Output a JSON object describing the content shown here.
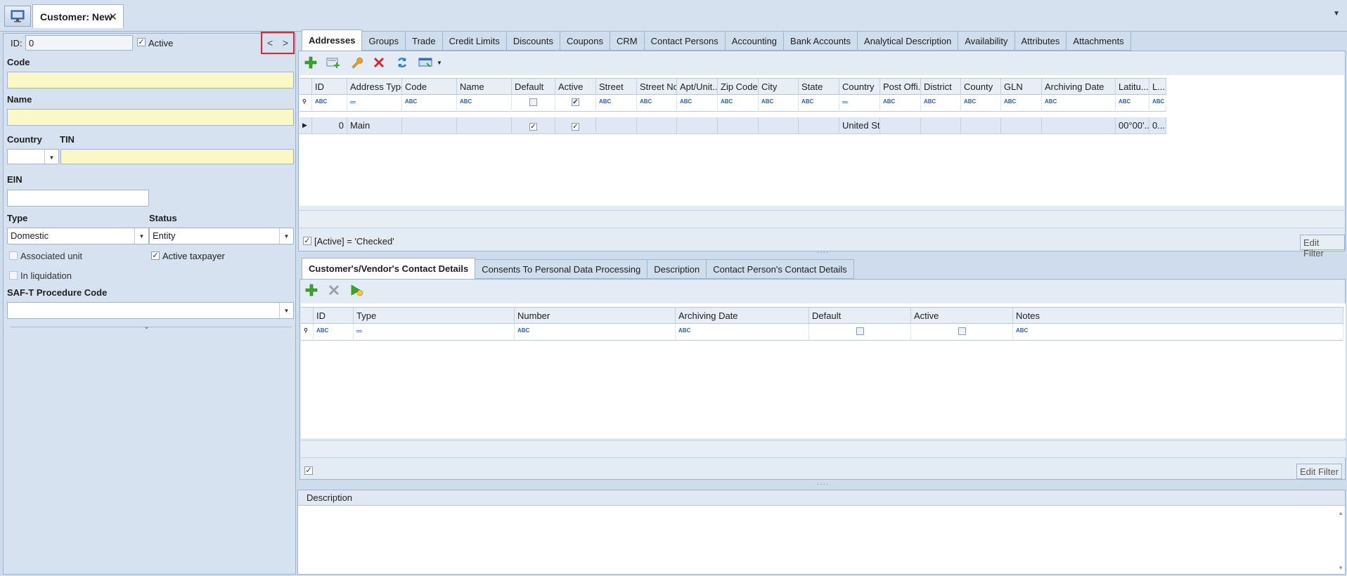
{
  "window": {
    "home_icon": "monitor-icon",
    "doc_tab_title": "Customer: New",
    "close_symbol": "✕",
    "menu_arrow": "▼"
  },
  "form": {
    "id_label": "ID:",
    "id_value": "0",
    "active_label": "Active",
    "active_checked": true,
    "nav_prev": "<",
    "nav_next": ">",
    "code_label": "Code",
    "code_value": "",
    "name_label": "Name",
    "name_value": "",
    "country_label": "Country",
    "country_value": "",
    "tin_label": "TIN",
    "tin_value": "",
    "ein_label": "EIN",
    "ein_value": "",
    "type_label": "Type",
    "type_value": "Domestic",
    "status_label": "Status",
    "status_value": "Entity",
    "associated_unit_label": "Associated unit",
    "active_taxpayer_label": "Active taxpayer",
    "in_liquidation_label": "In liquidation",
    "saft_label": "SAF-T Procedure Code",
    "saft_value": ""
  },
  "main_tabs": [
    "Addresses",
    "Groups",
    "Trade",
    "Credit Limits",
    "Discounts",
    "Coupons",
    "CRM",
    "Contact Persons",
    "Accounting",
    "Bank Accounts",
    "Analytical Description",
    "Availability",
    "Attributes",
    "Attachments"
  ],
  "addresses_grid": {
    "columns": [
      "ID",
      "Address Type",
      "Code",
      "Name",
      "Default",
      "Active",
      "Street",
      "Street No.",
      "Apt/Unit...",
      "Zip Code",
      "City",
      "State",
      "Country",
      "Post Offi...",
      "District",
      "County",
      "GLN",
      "Archiving Date",
      "Latitu...",
      "L..."
    ],
    "rows": [
      {
        "id": "0",
        "address_type": "Main",
        "default": true,
        "active": true,
        "country": "United St...",
        "latitude": "00°00'...",
        "longitude": "0..."
      }
    ],
    "filter_text": "[Active] = 'Checked'",
    "edit_filter_label": "Edit Filter"
  },
  "contact_tabs": [
    "Customer's/Vendor's Contact Details",
    "Consents To Personal Data Processing",
    "Description",
    "Contact Person's Contact Details"
  ],
  "contact_grid": {
    "columns": [
      "ID",
      "Type",
      "Number",
      "Archiving Date",
      "Default",
      "Active",
      "Notes"
    ],
    "edit_filter_label": "Edit Filter"
  },
  "description_panel": {
    "title": "Description"
  },
  "colors": {
    "accent_blue": "#2f5ea6",
    "required_field": "#fbf8c8",
    "highlight_border": "#e0282e"
  }
}
